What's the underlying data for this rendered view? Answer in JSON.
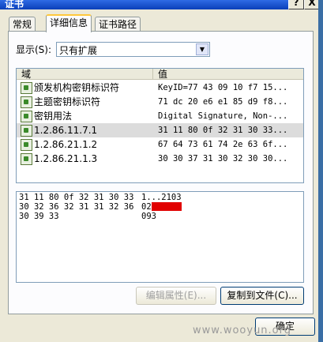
{
  "window": {
    "title": "证书",
    "help_label": "?",
    "close_label": "X"
  },
  "tabs": [
    {
      "label": "常规"
    },
    {
      "label": "详细信息"
    },
    {
      "label": "证书路径"
    }
  ],
  "show": {
    "label": "显示(S):",
    "selected": "只有扩展",
    "arrow": "▼"
  },
  "list": {
    "columns": {
      "field": "域",
      "value": "值"
    },
    "rows": [
      {
        "field": "颁发机构密钥标识符",
        "value": "KeyID=77 43 09 10 f7 15..."
      },
      {
        "field": "主题密钥标识符",
        "value": "71 dc 20 e6 e1 85 d9 f8..."
      },
      {
        "field": "密钥用法",
        "value": "Digital Signature, Non-..."
      },
      {
        "field": "1.2.86.11.7.1",
        "value": "31 11 80 0f 32 31 30 33..."
      },
      {
        "field": "1.2.86.21.1.2",
        "value": "67 64 73 61 74 2e 63 6f..."
      },
      {
        "field": "1.2.86.21.1.3",
        "value": "30 30 37 31 30 32 30 30..."
      }
    ]
  },
  "detail": {
    "lines": [
      {
        "hex": "31 11 80 0f 32 31 30 33",
        "ascii": "1...2103"
      },
      {
        "hex": "30 32 36 32 31 31 32 36",
        "ascii": "02"
      },
      {
        "hex": "30 39 33",
        "ascii": "093"
      }
    ]
  },
  "buttons": {
    "edit_properties": "编辑属性(E)...",
    "copy_to_file": "复制到文件(C)...",
    "ok": "确定"
  },
  "watermark": "www.wooyun.org",
  "colors": {
    "title_bar": "#0a3fb8",
    "redaction": "#e10000",
    "selected_row": "#dcdcdc"
  }
}
